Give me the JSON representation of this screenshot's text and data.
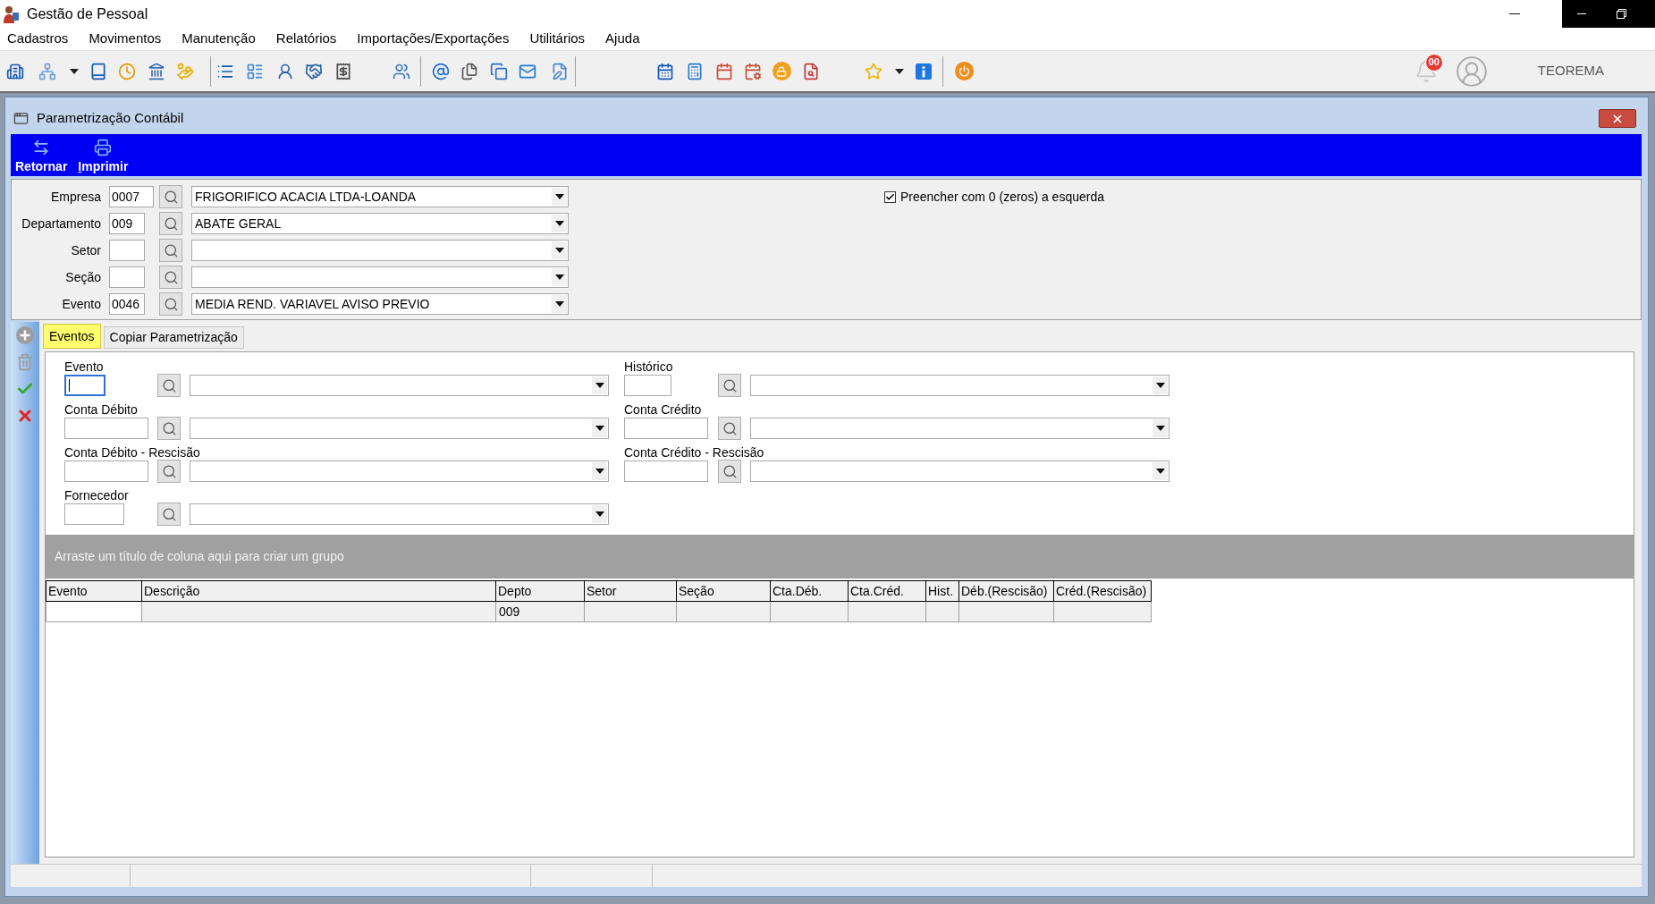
{
  "app": {
    "title": "Gestão de Pessoal",
    "notifications": "00",
    "user": "TEOREMA"
  },
  "menu": [
    "Cadastros",
    "Movimentos",
    "Manutenção",
    "Relatórios",
    "Importações/Exportações",
    "Utilitários",
    "Ajuda"
  ],
  "window": {
    "title": "Parametrização Contábil"
  },
  "actions": [
    {
      "kind": "return",
      "label": "Retornar",
      "mnemonic": false
    },
    {
      "kind": "print",
      "label": "Imprimir",
      "mnemonic": true
    }
  ],
  "filters": [
    {
      "label": "Empresa",
      "code": "0007",
      "value": "FRIGORIFICO ACACIA LTDA-LOANDA"
    },
    {
      "label": "Departamento",
      "code": "009",
      "value": "ABATE GERAL"
    },
    {
      "label": "Setor"
    },
    {
      "label": "Seção"
    },
    {
      "label": "Evento",
      "code": "0046",
      "value": "MEDIA REND. VARIAVEL AVISO PREVIO"
    }
  ],
  "zero_fill": {
    "label": "Preencher com 0 (zeros) a esquerda",
    "checked": true
  },
  "record_actions": [
    {
      "kind": "add",
      "disabled": true
    },
    {
      "kind": "delete",
      "disabled": true
    },
    {
      "kind": "confirm",
      "disabled": false
    },
    {
      "kind": "cancel",
      "disabled": false
    }
  ],
  "tabs": [
    {
      "label": "Eventos",
      "selected": true
    },
    {
      "label": "Copiar Parametrização",
      "selected": false
    }
  ],
  "event_form": {
    "left": [
      {
        "label": "Evento",
        "focused": true
      },
      {
        "label": "Conta Débito",
        "focused": false
      },
      {
        "label": "Conta Débito - Rescisão",
        "focused": false
      },
      {
        "label": "Fornecedor",
        "focused": false
      }
    ],
    "right": [
      {
        "label": "Histórico",
        "focused": false
      },
      {
        "label": "Conta Crédito",
        "focused": false
      },
      {
        "label": "Conta Crédito - Rescisão",
        "focused": false
      }
    ]
  },
  "group_panel": {
    "hint": "Arraste um título de coluna aqui para criar um grupo"
  },
  "table": {
    "columns": [
      "Evento",
      "Descrição",
      "Depto",
      "Setor",
      "Seção",
      "Cta.Déb.",
      "Cta.Créd.",
      "Hist.",
      "Déb.(Rescisão)",
      "Créd.(Rescisão)"
    ],
    "rows": [
      {
        "cells": [
          {
            "focused": true
          },
          {
            "focused": false
          },
          {
            "text": "009",
            "focused": false
          },
          {
            "focused": false
          },
          {
            "focused": false
          },
          {
            "focused": false
          },
          {
            "focused": false
          },
          {
            "focused": false
          },
          {
            "focused": false
          },
          {
            "focused": false
          }
        ]
      }
    ]
  }
}
